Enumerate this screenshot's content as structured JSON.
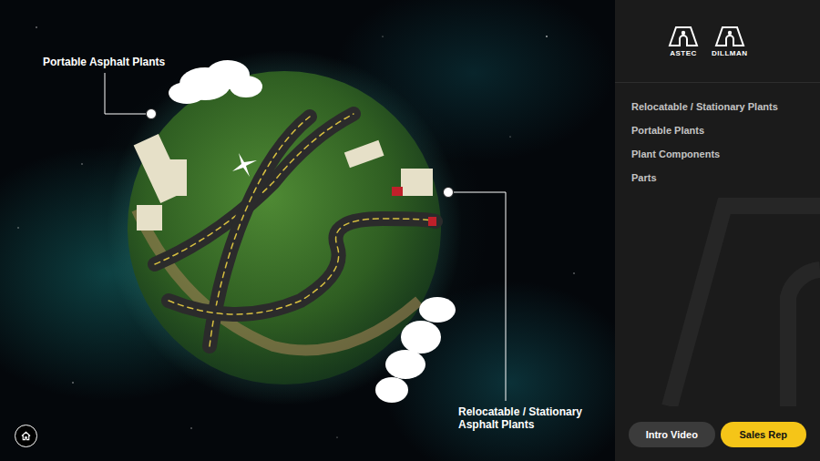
{
  "brands": [
    {
      "name": "ASTEC"
    },
    {
      "name": "DILLMAN"
    }
  ],
  "menu": [
    {
      "label": "Relocatable / Stationary Plants"
    },
    {
      "label": "Portable Plants"
    },
    {
      "label": "Plant Components"
    },
    {
      "label": "Parts"
    }
  ],
  "callouts": [
    {
      "label": "Portable Asphalt Plants"
    },
    {
      "label": "Relocatable / Stationary Asphalt Plants"
    }
  ],
  "buttons": [
    {
      "label": "Intro Video",
      "kind": "secondary"
    },
    {
      "label": "Sales Rep",
      "kind": "primary"
    }
  ]
}
